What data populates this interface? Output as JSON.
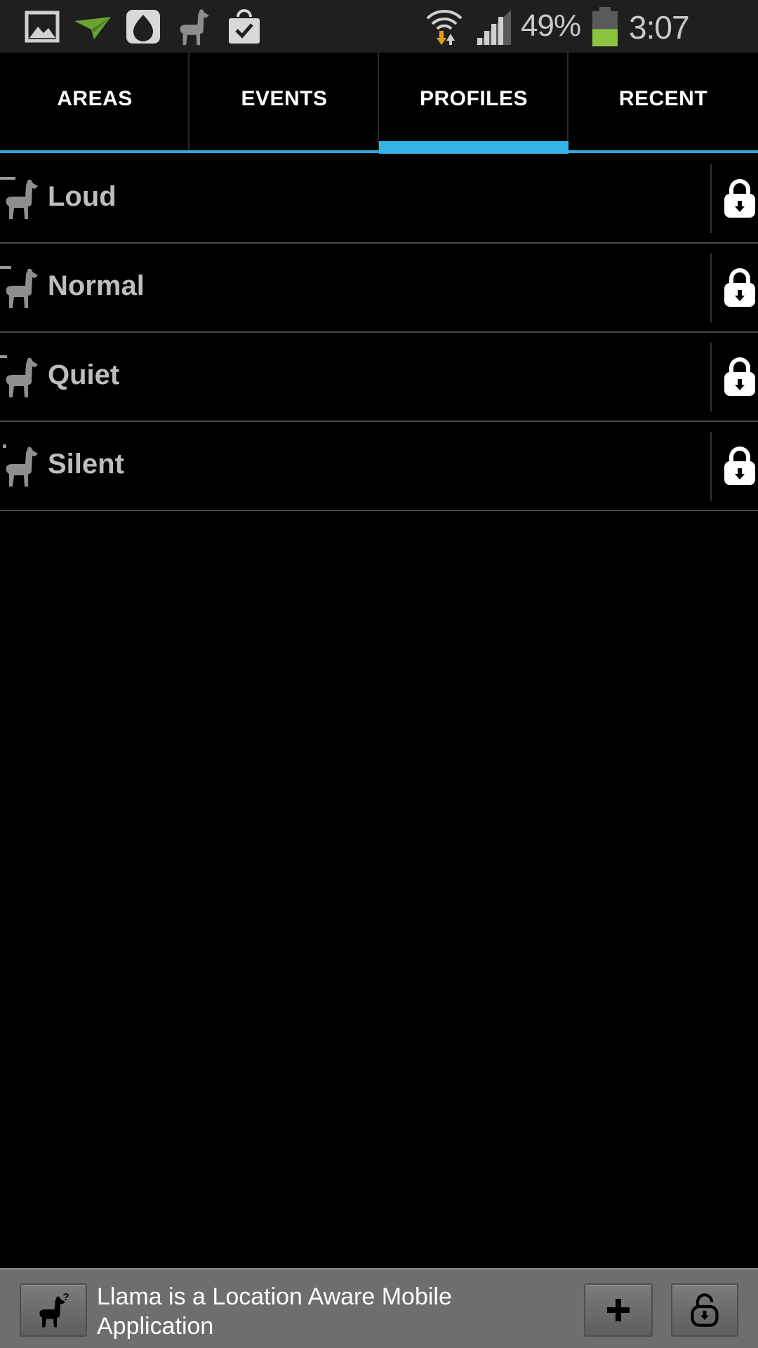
{
  "status_bar": {
    "battery_percent": "49%",
    "time": "3:07",
    "left_icons": [
      "gallery-icon",
      "paper-plane-icon",
      "droplet-icon",
      "llama-icon",
      "shopping-bag-icon"
    ],
    "right_icons": [
      "wifi-icon",
      "signal-icon",
      "battery-icon"
    ],
    "battery_level": 0.49,
    "battery_color": "#8bc53f"
  },
  "tabs": {
    "items": [
      {
        "label": "AREAS"
      },
      {
        "label": "EVENTS"
      },
      {
        "label": "PROFILES"
      },
      {
        "label": "RECENT"
      }
    ],
    "active": "PROFILES",
    "accent_color": "#35b3e6"
  },
  "profiles": [
    {
      "name": "Loud",
      "icon": "llama-icon",
      "action_icon": "lock-icon"
    },
    {
      "name": "Normal",
      "icon": "llama-icon",
      "action_icon": "lock-icon"
    },
    {
      "name": "Quiet",
      "icon": "llama-icon",
      "action_icon": "lock-icon"
    },
    {
      "name": "Silent",
      "icon": "llama-icon",
      "action_icon": "lock-icon"
    }
  ],
  "bottom_bar": {
    "message": "Llama is a Location Aware Mobile Application",
    "buttons": [
      "llama-help-icon",
      "plus-icon",
      "unlock-icon"
    ]
  }
}
